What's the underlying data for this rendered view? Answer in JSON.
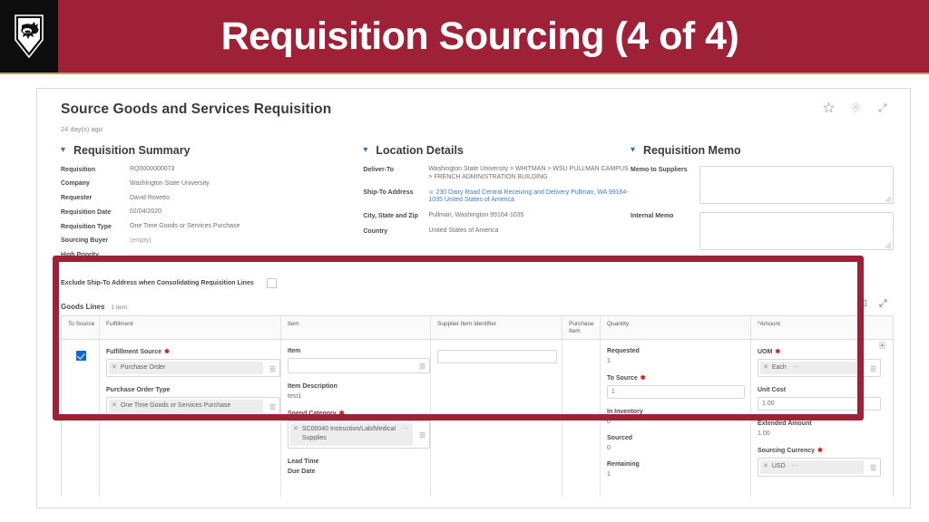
{
  "slide": {
    "title": "Requisition Sourcing (4 of 4)",
    "brand_color": "#9e2137",
    "accent_color": "#c79a55",
    "logo_name": "wsu-cougar-shield-logo"
  },
  "app": {
    "title": "Source Goods and Services Requisition",
    "subtitle": "24 day(s) ago",
    "titlebar_icons": [
      "favorite-star-icon",
      "gear-icon",
      "expand-icon"
    ]
  },
  "requisition_summary": {
    "section_title": "Requisition Summary",
    "fields": [
      {
        "label": "Requisition",
        "value": "RQ0000000073"
      },
      {
        "label": "Company",
        "value": "Washington State University"
      },
      {
        "label": "Requester",
        "value": "David Rovetto"
      },
      {
        "label": "Requisition Date",
        "value": "02/04/2020"
      },
      {
        "label": "Requisition Type",
        "value": "One Time Goods or Services Purchase"
      },
      {
        "label": "Sourcing Buyer",
        "value": "(empty)"
      },
      {
        "label": "High Priority",
        "value": ""
      }
    ]
  },
  "location_details": {
    "section_title": "Location Details",
    "deliver_to_label": "Deliver-To",
    "deliver_to_value": "Washington State University > WHITMAN > WSU PULLMAN CAMPUS > FRENCH ADMINISTRATION BUILDING",
    "ship_to_label": "Ship-To Address",
    "ship_to_value": "230 Dairy Road Central Receiving and Delivery Pullman, WA 99164-1035 United States of America",
    "city_state_zip_label": "City, State and Zip",
    "city_state_zip_value": "Pullman, Washington 99164-1035",
    "country_label": "Country",
    "country_value": "United States of America"
  },
  "requisition_memo": {
    "section_title": "Requisition Memo",
    "memo_to_suppliers_label": "Memo to Suppliers",
    "memo_to_suppliers_value": "",
    "internal_memo_label": "Internal Memo",
    "internal_memo_value": ""
  },
  "exclude": {
    "label": "Exclude Ship-To Address when Consolidating Requisition Lines",
    "checked": false
  },
  "goods_lines": {
    "title": "Goods Lines",
    "count": "1 item",
    "toolbar_icons": [
      "grid-view-icon",
      "expand-icon"
    ],
    "columns": [
      "To Source",
      "Fulfillment",
      "Item",
      "Supplier Item Identifier",
      "Purchase Item",
      "Quantity",
      "*Amount"
    ],
    "row": {
      "to_source_checked": true,
      "fulfillment": {
        "fulfillment_source_label": "Fulfillment Source",
        "fulfillment_source_value": "Purchase Order",
        "purchase_order_type_label": "Purchase Order Type",
        "purchase_order_type_value": "One Time Goods or Services Purchase"
      },
      "item": {
        "item_label": "Item",
        "item_value": "",
        "item_description_label": "Item Description",
        "item_description_value": "test1",
        "spend_category_label": "Spend Category",
        "spend_category_value": "SC00040 Instruction/Lab/Medical Supplies",
        "lead_time_label": "Lead Time",
        "due_date_label": "Due Date"
      },
      "supplier_item_identifier": "",
      "purchase_item": "",
      "quantity": {
        "requested_label": "Requested",
        "requested_value": "1",
        "to_source_label": "To Source",
        "to_source_value": "1",
        "in_inventory_label": "In Inventory",
        "in_inventory_value": "0",
        "sourced_label": "Sourced",
        "sourced_value": "0",
        "remaining_label": "Remaining",
        "remaining_value": "1"
      },
      "amount": {
        "uom_label": "UOM",
        "uom_value": "Each",
        "unit_cost_label": "Unit Cost",
        "unit_cost_value": "1.00",
        "extended_amount_label": "Extended Amount",
        "extended_amount_value": "1.00",
        "sourcing_currency_label": "Sourcing Currency",
        "sourcing_currency_value": "USD"
      }
    }
  }
}
